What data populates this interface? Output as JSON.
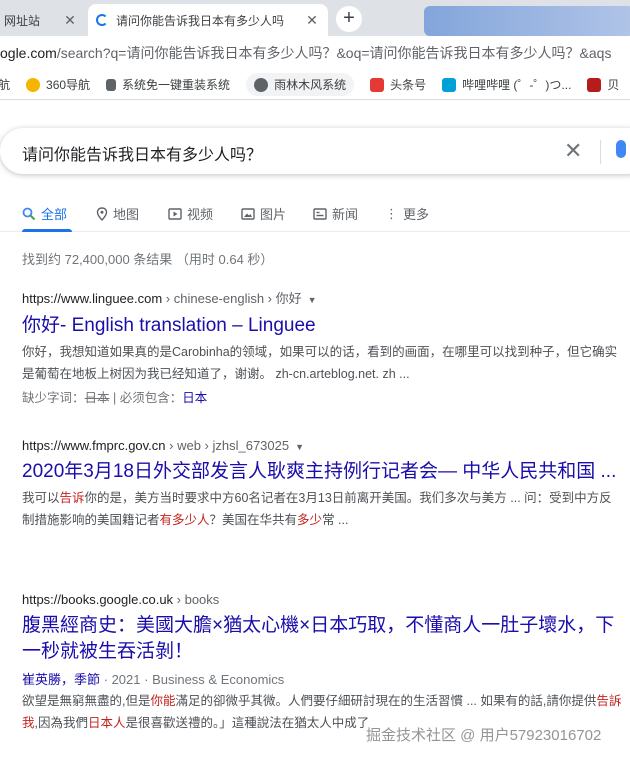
{
  "browser": {
    "tabs": [
      {
        "label": "网址站",
        "close": "✕"
      },
      {
        "label": "请问你能告诉我日本有多少人吗",
        "close": "✕"
      }
    ],
    "new_tab": "+",
    "address": {
      "host": "ogle.com",
      "rest": "/search?q=请问你能告诉我日本有多少人吗？&oq=请问你能告诉我日本有多少人吗？&aqs"
    },
    "bookmarks": [
      {
        "label": "航",
        "icon": "globe-icon"
      },
      {
        "label": "360导航",
        "icon": "360-icon"
      },
      {
        "label": "系统免一键重装系统",
        "icon": "tool-icon"
      },
      {
        "label": "雨林木风系统",
        "icon": "globe-icon"
      },
      {
        "label": "头条号",
        "icon": "toutiao-icon"
      },
      {
        "label": "哔哩哔哩 (゜-゜)つ...",
        "icon": "bilibili-icon"
      },
      {
        "label": "贝",
        "icon": "app-icon"
      }
    ]
  },
  "search": {
    "query": "请问你能告诉我日本有多少人吗？",
    "clear": "✕"
  },
  "nav": {
    "tabs": [
      {
        "label": "全部",
        "icon": "search-icon"
      },
      {
        "label": "地图",
        "icon": "map-pin-icon"
      },
      {
        "label": "视频",
        "icon": "video-icon"
      },
      {
        "label": "图片",
        "icon": "image-icon"
      },
      {
        "label": "新闻",
        "icon": "news-icon"
      },
      {
        "label": "更多",
        "icon": "more-icon"
      }
    ],
    "more_prefix": "⋮"
  },
  "stats": "找到约 72,400,000 条结果 （用时 0.64 秒）",
  "results": [
    {
      "site": "https://www.linguee.com",
      "path": " › chinese-english › 你好",
      "title": "你好- English translation – Linguee",
      "snippet_1": "你好，我想知道如果真的是Carobinha的领域，如果可以的话，看到的画面，在哪里可以找到种子，但它确实是葡萄在地板上树因为我已经知道了，谢谢。 zh-cn.arteblog.net. zh ...",
      "missing_label": "缺少字词：",
      "missing_word": "日本",
      "required_label": " | 必须包含：",
      "required_word": "日本"
    },
    {
      "site": "https://www.fmprc.gov.cn",
      "path": " › web › jzhsl_673025",
      "title": "2020年3月18日外交部发言人耿爽主持例行记者会— 中华人民共和国 ...",
      "snip_a": "我可以",
      "snip_hl1": "告诉",
      "snip_b": "你的是，美方当时要求中方60名记者在3月13日前离开美国。我们多次与美方 ... 问：受到中方反制措施影响的美国籍记者",
      "snip_hl2": "有多少人",
      "snip_c": "？美国在华共有",
      "snip_hl3": "多少",
      "snip_d": "常 ..."
    },
    {
      "site": "https://books.google.co.uk",
      "path": " › books",
      "title": "腹黑經商史：美國大膽×猶太心機×日本巧取，不懂商人一肚子壞水，下一秒就被生吞活剝！",
      "author": "崔英勝，季節",
      "year": "2021",
      "category": "Business & Economics",
      "snip_a": "欲望是無窮無盡的,但是",
      "snip_hl1": "你能",
      "snip_b": "滿足的卻微乎其微。人們要仔細研討現在的生活習慣 ... 如果有的話,請你提供",
      "snip_hl2": "告訴我",
      "snip_c": ",因為我們",
      "snip_hl3": "日本人",
      "snip_d": "是很喜歡送禮的。」這種說法在猶太人中成了"
    }
  ],
  "watermark": "掘金技术社区 @ 用户57923016702",
  "colors": {
    "link": "#1a0dab",
    "accent": "#1a73e8",
    "highlight": "#c5221f"
  }
}
